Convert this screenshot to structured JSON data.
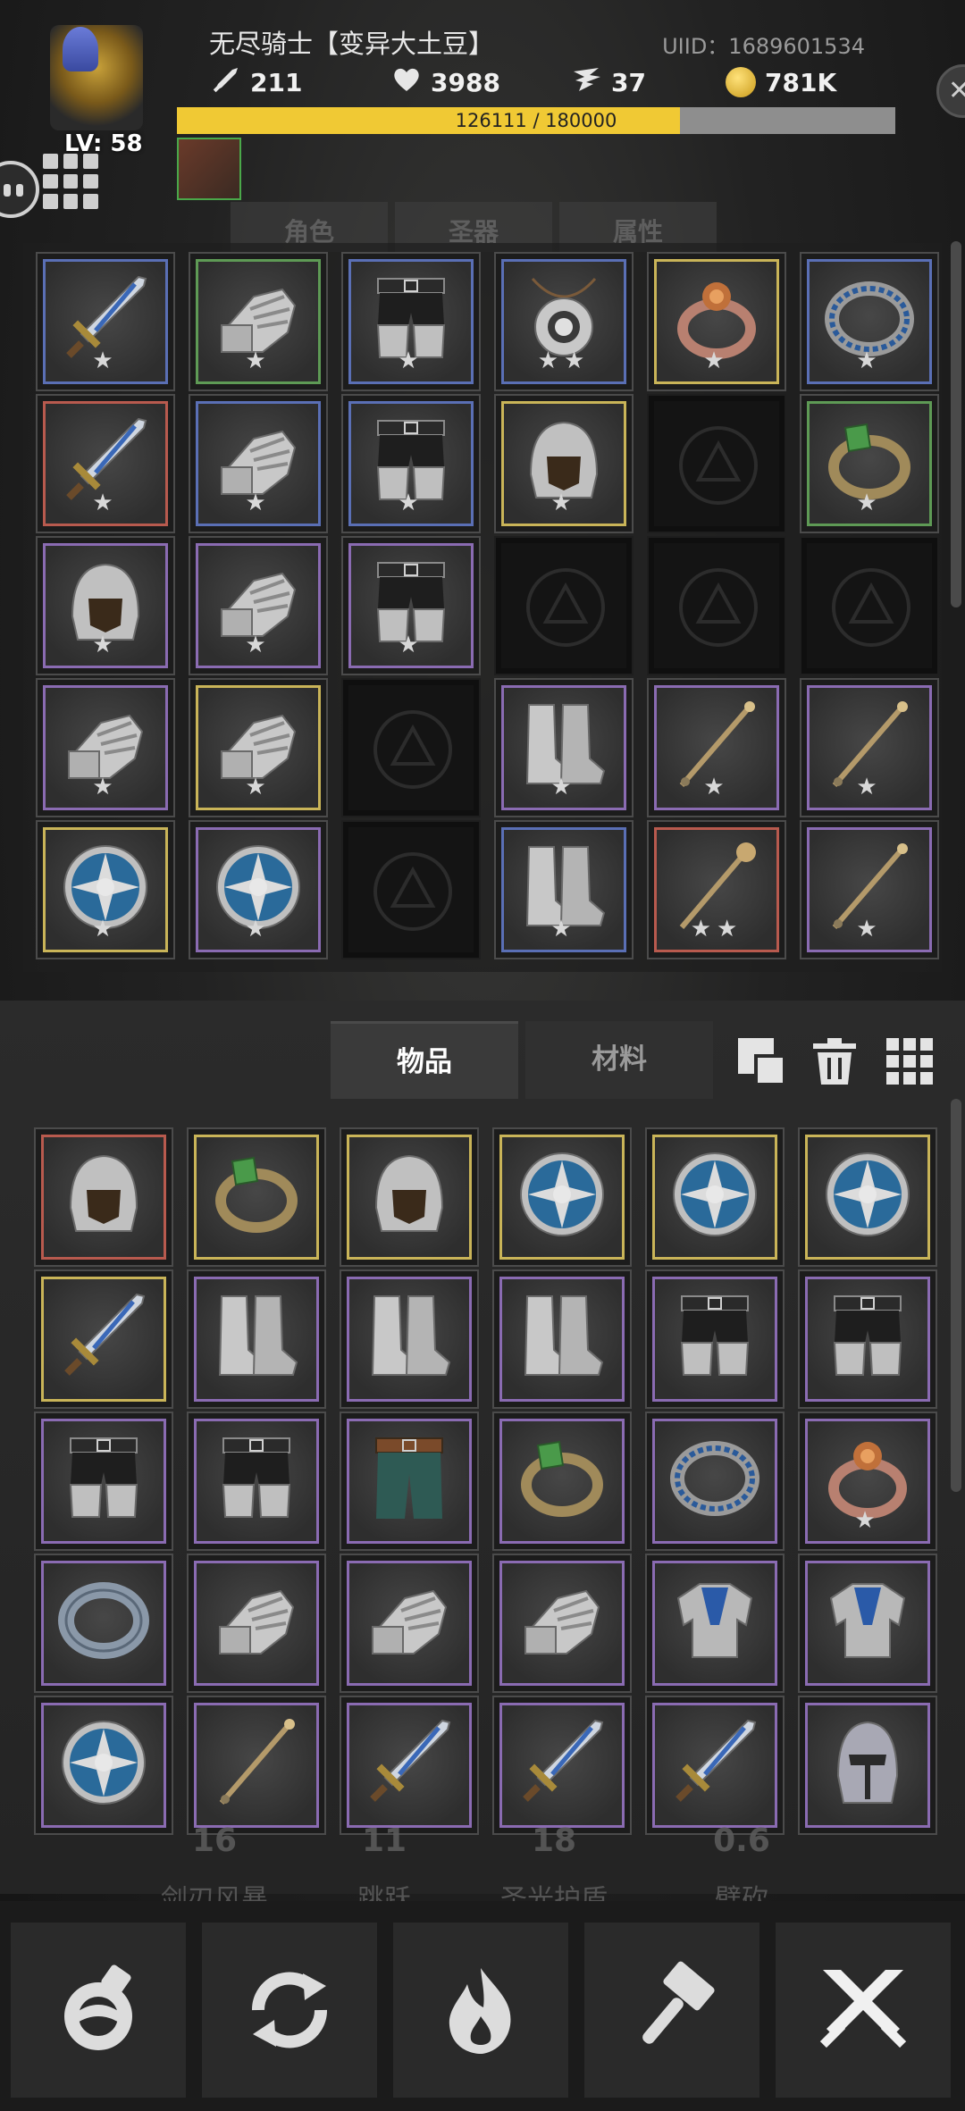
{
  "player": {
    "name": "无尽骑士【变异大土豆】",
    "uid": "UIID：1689601534",
    "level": "LV: 58",
    "attack": "211",
    "health": "3988",
    "speed": "37",
    "gold": "781K",
    "xp_text": "126111 / 180000",
    "xp_fraction": 0.7006
  },
  "top_tabs": [
    "角色",
    "圣器",
    "属性"
  ],
  "equipment": [
    [
      "sword:blue:1",
      "gauntlet:green:1",
      "pants:blue:1",
      "amulet:blue:2",
      "ring-red:gold:1",
      "ring-rune:blue:1"
    ],
    [
      "sword:red:1",
      "gauntlet:blue:1",
      "pants:blue:1",
      "helmet:gold:1",
      "empty",
      "ring-green:green:1"
    ],
    [
      "helmet:purple:1",
      "gauntlet:purple:1",
      "pants:purple:1",
      "empty",
      "empty",
      "empty"
    ],
    [
      "gauntlet:purple:1",
      "gauntlet:gold:1",
      "empty",
      "boots:purple:1",
      "staff:purple:1",
      "staff:purple:1"
    ],
    [
      "shield:gold:1",
      "shield:purple:1",
      "empty",
      "boots:blue:1",
      "mace:red:2",
      "staff:purple:1"
    ]
  ],
  "bag_tabs": {
    "items": "物品",
    "materials": "材料"
  },
  "bag": [
    [
      "helmet:red:0",
      "ring-green:gold:0",
      "helmet:gold:0",
      "shield:gold:0",
      "shield:gold:0",
      "shield:gold:0"
    ],
    [
      "sword:gold:0",
      "boots:purple:0",
      "boots:purple:0",
      "boots:purple:0",
      "pants:purple:0",
      "pants:purple:0"
    ],
    [
      "pants:purple:0",
      "pants:purple:0",
      "pants-green:purple:0",
      "ring-green:purple:0",
      "ring-rune:purple:0",
      "ring-red:purple:1"
    ],
    [
      "ring-plain:purple:0",
      "gauntlet:purple:0",
      "gauntlet:purple:0",
      "gauntlet:purple:0",
      "armor:purple:0",
      "armor:purple:0"
    ],
    [
      "shield:purple:0",
      "staff:purple:0",
      "sword:purple:0",
      "sword:purple:0",
      "sword:purple:0",
      "helmet-grey:purple:0"
    ]
  ],
  "skills": [
    {
      "value": "16",
      "name": "剑刃风暴"
    },
    {
      "value": "11",
      "name": "跳跃"
    },
    {
      "value": "18",
      "name": "圣光护盾"
    },
    {
      "value": "0.6",
      "name": "劈砍"
    }
  ],
  "bottom_buttons": [
    "potion-icon",
    "refresh-icon",
    "flame-icon",
    "hammer-icon",
    "crossed-swords-icon"
  ],
  "colors": {
    "xp_fill": "#f0c934",
    "accent": "#cfcfcf"
  }
}
